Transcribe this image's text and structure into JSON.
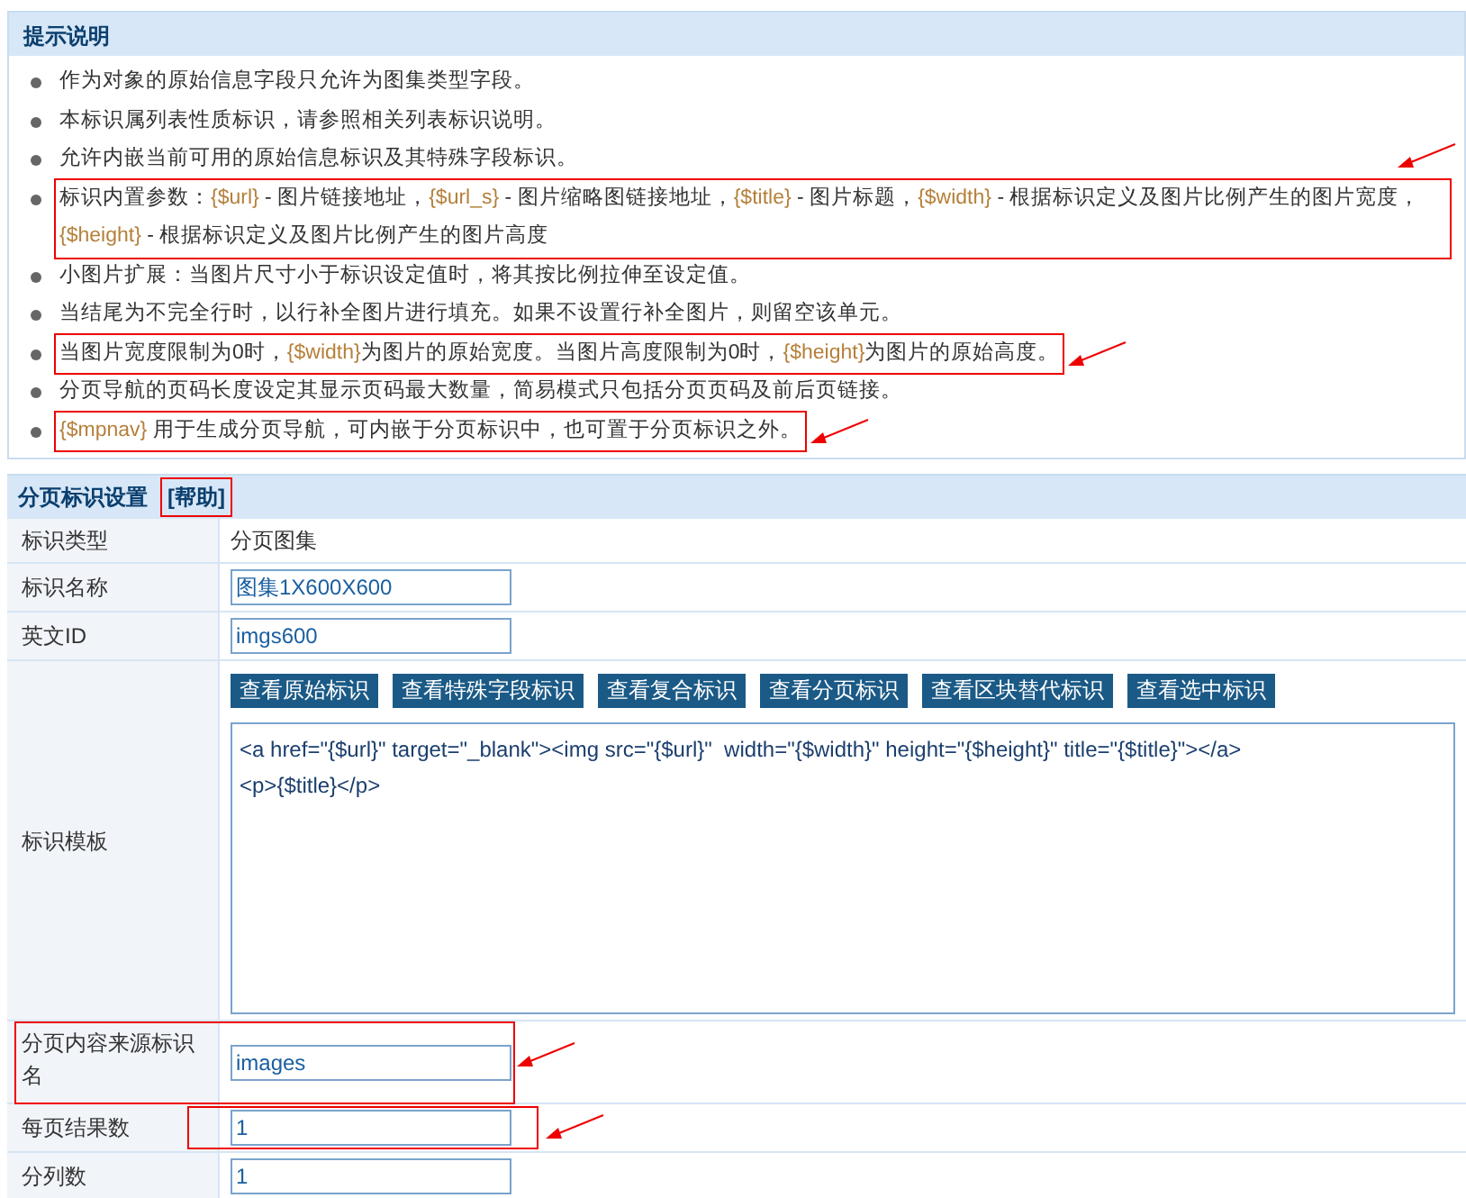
{
  "notes_panel": {
    "title": "提示说明",
    "items": [
      {
        "highlighted": false,
        "parts": [
          {
            "text": "作为对象的原始信息字段只允许为图集类型字段。",
            "token": false
          }
        ]
      },
      {
        "highlighted": false,
        "parts": [
          {
            "text": "本标识属列表性质标识，请参照相关列表标识说明。",
            "token": false
          }
        ]
      },
      {
        "highlighted": false,
        "parts": [
          {
            "text": "允许内嵌当前可用的原始信息标识及其特殊字段标识。",
            "token": false
          }
        ]
      },
      {
        "highlighted": true,
        "parts": [
          {
            "text": "标识内置参数：",
            "token": false
          },
          {
            "text": "{$url}",
            "token": true
          },
          {
            "text": " - 图片链接地址，",
            "token": false
          },
          {
            "text": "{$url_s}",
            "token": true
          },
          {
            "text": " - 图片缩略图链接地址，",
            "token": false
          },
          {
            "text": "{$title}",
            "token": true
          },
          {
            "text": " - 图片标题，",
            "token": false
          },
          {
            "text": "{$width}",
            "token": true
          },
          {
            "text": " - 根据标识定义及图片比例产生的图片宽度，",
            "token": false
          },
          {
            "text": "{$height}",
            "token": true
          },
          {
            "text": " - 根据标识定义及图片比例产生的图片高度",
            "token": false
          }
        ]
      },
      {
        "highlighted": false,
        "parts": [
          {
            "text": "小图片扩展：当图片尺寸小于标识设定值时，将其按比例拉伸至设定值。",
            "token": false
          }
        ]
      },
      {
        "highlighted": false,
        "parts": [
          {
            "text": "当结尾为不完全行时，以行补全图片进行填充。如果不设置行补全图片，则留空该单元。",
            "token": false
          }
        ]
      },
      {
        "highlighted": true,
        "parts": [
          {
            "text": "当图片宽度限制为0时，",
            "token": false
          },
          {
            "text": "{$width}",
            "token": true
          },
          {
            "text": "为图片的原始宽度。当图片高度限制为0时，",
            "token": false
          },
          {
            "text": "{$height}",
            "token": true
          },
          {
            "text": "为图片的原始高度。",
            "token": false
          }
        ]
      },
      {
        "highlighted": false,
        "parts": [
          {
            "text": "分页导航的页码长度设定其显示页码最大数量，简易模式只包括分页页码及前后页链接。",
            "token": false
          }
        ]
      },
      {
        "highlighted": true,
        "parts": [
          {
            "text": "{$mpnav}",
            "token": true
          },
          {
            "text": " 用于生成分页导航，可内嵌于分页标识中，也可置于分页标识之外。",
            "token": false
          }
        ]
      }
    ]
  },
  "settings": {
    "title": "分页标识设置",
    "help_link": {
      "label": "[帮助]",
      "highlighted": true
    },
    "rows": [
      {
        "kind": "text",
        "label": "标识类型",
        "value": "分页图集",
        "highlighted": false
      },
      {
        "kind": "input",
        "label": "标识名称",
        "value": "图集1X600X600",
        "highlighted": false
      },
      {
        "kind": "input",
        "label": "英文ID",
        "value": "imgs600",
        "highlighted": false
      },
      {
        "kind": "template",
        "label": "标识模板",
        "buttons": [
          "查看原始标识",
          "查看特殊字段标识",
          "查看复合标识",
          "查看分页标识",
          "查看区块替代标识",
          "查看选中标识"
        ],
        "value": "<a href=\"{$url}\" target=\"_blank\"><img src=\"{$url}\"  width=\"{$width}\" height=\"{$height}\" title=\"{$title}\"></a>\n<p>{$title}</p>",
        "highlighted": false
      },
      {
        "kind": "input",
        "label": "分页内容来源标识名",
        "value": "images",
        "highlighted": true,
        "label_highlighted": true
      },
      {
        "kind": "input",
        "label": "每页结果数",
        "value": "1",
        "highlighted": true,
        "label_highlighted": false
      },
      {
        "kind": "input",
        "label": "分列数",
        "value": "1",
        "highlighted": false
      }
    ]
  }
}
